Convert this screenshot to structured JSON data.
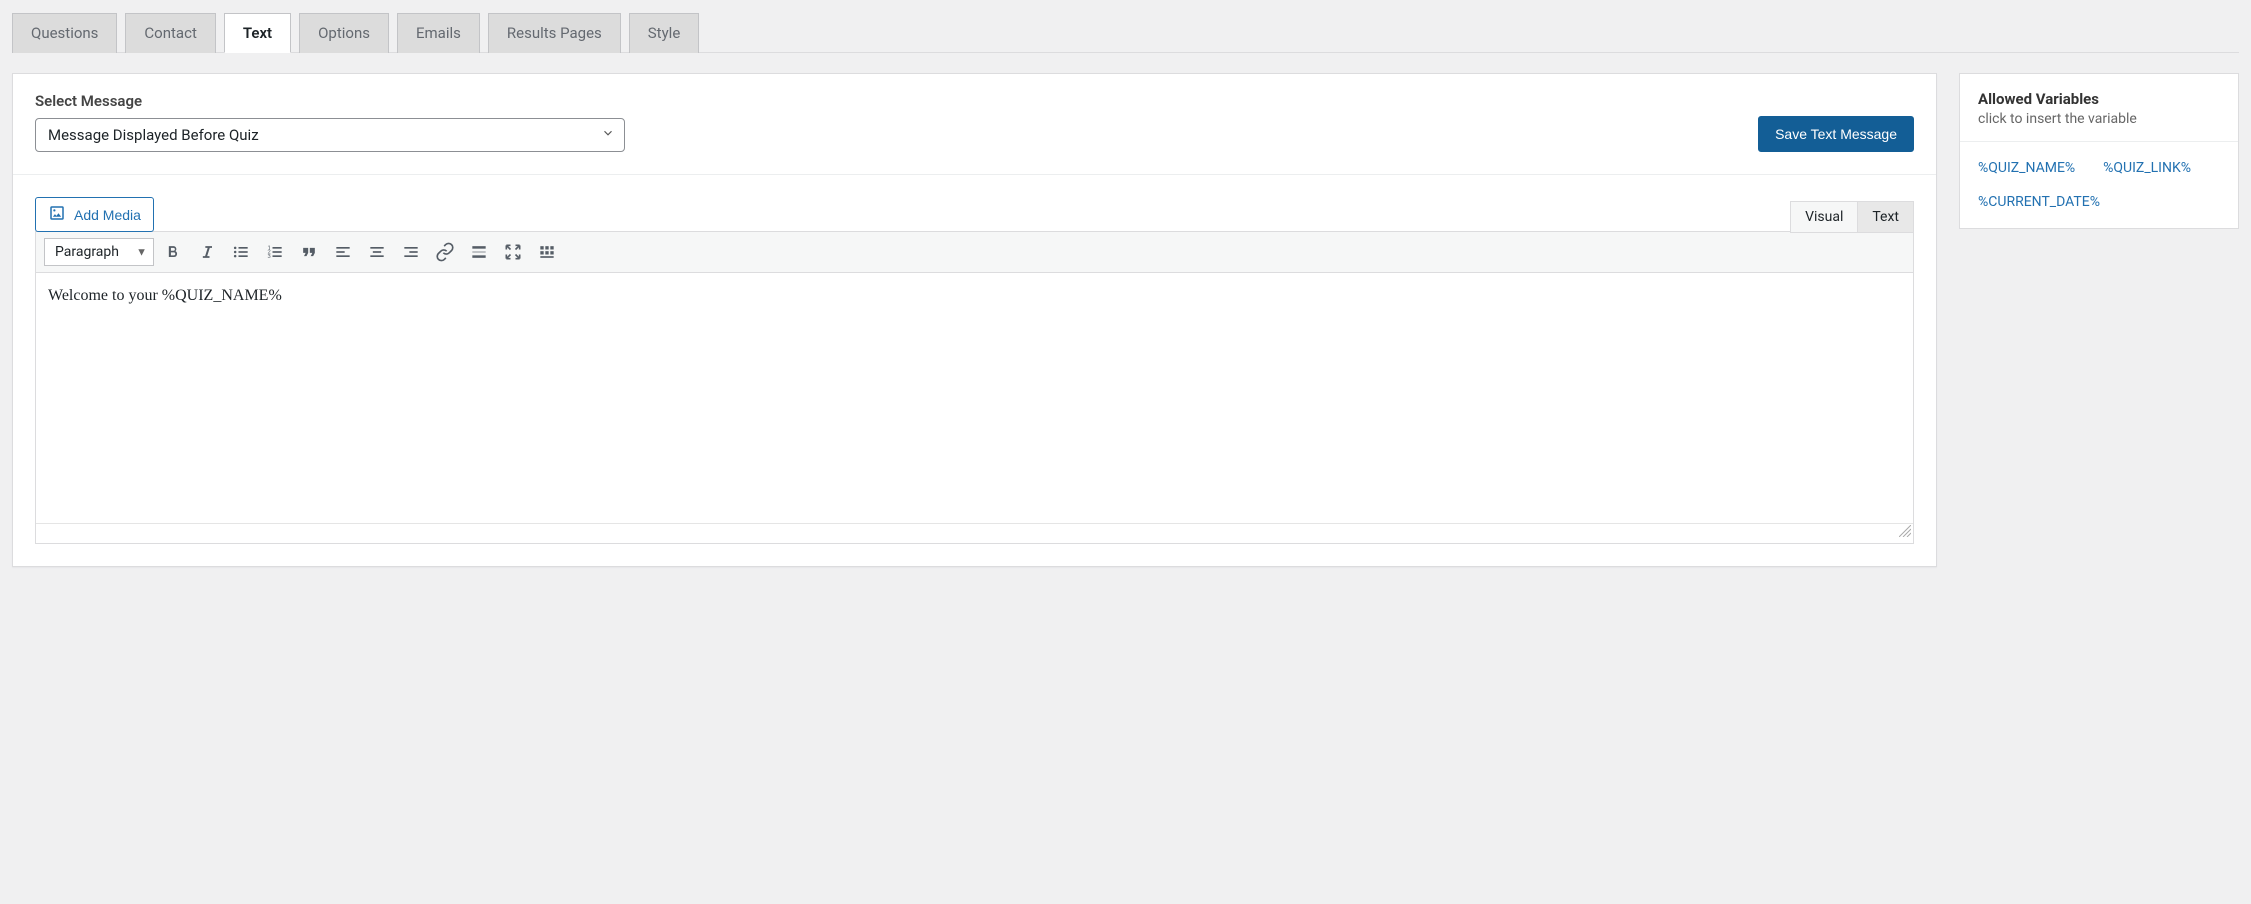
{
  "tabs": [
    {
      "label": "Questions",
      "active": false
    },
    {
      "label": "Contact",
      "active": false
    },
    {
      "label": "Text",
      "active": true
    },
    {
      "label": "Options",
      "active": false
    },
    {
      "label": "Emails",
      "active": false
    },
    {
      "label": "Results Pages",
      "active": false
    },
    {
      "label": "Style",
      "active": false
    }
  ],
  "main": {
    "select_label": "Select Message",
    "select_value": "Message Displayed Before Quiz",
    "save_button": "Save Text Message",
    "add_media": "Add Media",
    "editor_tabs": {
      "visual": "Visual",
      "text": "Text"
    },
    "format_value": "Paragraph",
    "content": "Welcome to your %QUIZ_NAME%"
  },
  "sidebar": {
    "title": "Allowed Variables",
    "subtitle": "click to insert the variable",
    "vars": [
      "%QUIZ_NAME%",
      "%QUIZ_LINK%",
      "%CURRENT_DATE%"
    ]
  }
}
